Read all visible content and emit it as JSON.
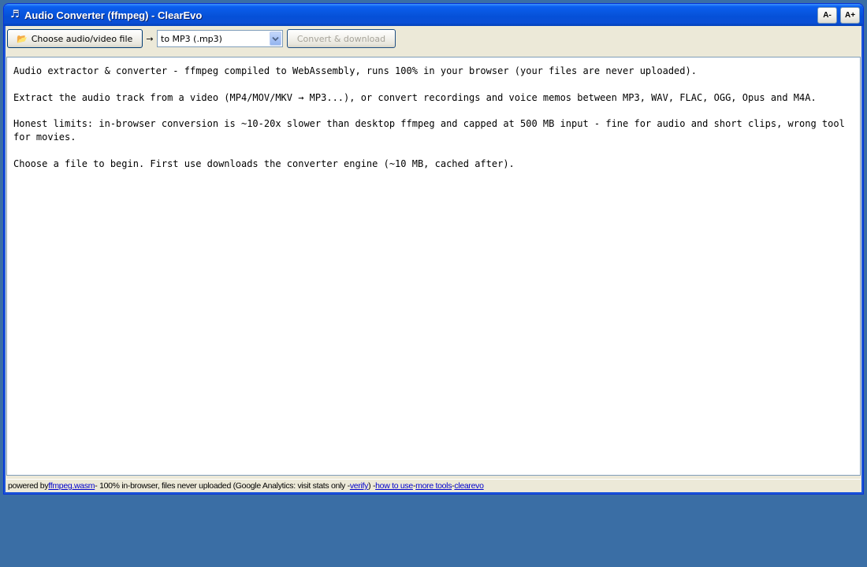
{
  "window": {
    "title_icon": "music-note-icon",
    "title": "Audio Converter (ffmpeg) - ClearEvo",
    "font_decrease_label": "A-",
    "font_increase_label": "A+",
    "titlebar_color": "#0855dd"
  },
  "toolbar": {
    "choose_icon": "folder-icon",
    "choose_label": "Choose audio/video file",
    "arrow": "→",
    "format_select": {
      "selected": "to MP3 (.mp3)"
    },
    "convert_label": "Convert & download",
    "convert_enabled": false
  },
  "content": {
    "paragraphs": [
      "Audio extractor & converter - ffmpeg compiled to WebAssembly, runs 100% in your browser (your files are never uploaded).",
      "Extract the audio track from a video (MP4/MOV/MKV → MP3...), or convert recordings and voice memos between MP3, WAV, FLAC, OGG, Opus and M4A.",
      "Honest limits: in-browser conversion is ~10-20x slower than desktop ffmpeg and capped at 500 MB input - fine for audio and short clips, wrong tool for movies.",
      "Choose a file to begin. First use downloads the converter engine (~10 MB, cached after)."
    ]
  },
  "statusbar": {
    "powered_prefix": "powered by ",
    "ffmpeg_link": "ffmpeg.wasm",
    "middle_text": " - 100% in-browser, files never uploaded (Google Analytics: visit stats only - ",
    "verify_link": "verify",
    "sep1": ") - ",
    "how_to_use_link": "how to use",
    "sep2": " - ",
    "more_tools_link": "more tools",
    "sep3": " - ",
    "clearevo_link": "clearevo",
    "link_color": "#0000cc"
  },
  "desktop": {
    "background_color": "#3a6ea5"
  }
}
